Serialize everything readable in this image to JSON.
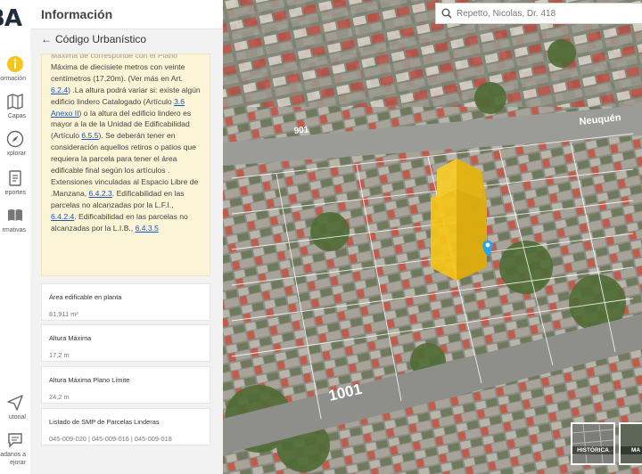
{
  "app": {
    "logo_text": "BA"
  },
  "rail": {
    "items": [
      {
        "label": "ormación",
        "icon": "info-icon"
      },
      {
        "label": "Capas",
        "icon": "map-layers-icon"
      },
      {
        "label": "xplorar",
        "icon": "compass-icon"
      },
      {
        "label": "eportes",
        "icon": "report-icon"
      },
      {
        "label": "rmativas",
        "icon": "book-icon"
      },
      {
        "label": "utorial",
        "icon": "paper-plane-icon"
      },
      {
        "label": "dadanos a\nejorar",
        "icon": "chat-icon"
      }
    ]
  },
  "panel": {
    "title": "Información",
    "back_label": "Código Urbanístico",
    "note": {
      "faded_line": "Máxima de corresponde con el Plano",
      "t1": "Máxima de diecisiete metros con veinte centímetros (17,20m). (Ver más en Art. ",
      "l1": "6.2.4",
      "t2": ") .La altura podrá variar si: existe algún edificio lindero Catalogado (Artículo ",
      "l2": "3.6 Anexo II",
      "t3": ") o la altura del edificio lindero es mayor a la de la Unidad de Edificabilidad (Artículo ",
      "l3": "6.5.5",
      "t4": "). Se deberán tener en consideración aquellos retiros o patios que requiera la parcela para tener el área edificable final según los artículos . Extensiones vinculadas al Espacio Libre de .Manzana, ",
      "l4": "6.4.2.3",
      "t5": ". Edificabilidad en las parcelas no alcanzadas por la L.F.I., ",
      "l5": "6.4.2.4",
      "t6": ". Edificabilidad en las parcelas no alcanzadas por la L.I.B., ",
      "l6": "6.4.3.5"
    },
    "cards": [
      {
        "label": "Área edificable en planta",
        "value": "81,911 m²"
      },
      {
        "label": "Altura Máxima",
        "value": "17,2 m"
      },
      {
        "label": "Altura Máxima Plano Límite",
        "value": "24,2 m"
      },
      {
        "label": "Listado de SMP de Parcelas Linderas",
        "value": "045-009-020 | 045-009-016 | 045-009-018"
      }
    ]
  },
  "map": {
    "search_value": "Repetto, Nicolas, Dr. 418",
    "street_labels": [
      "1001",
      "901",
      "Neuquén"
    ],
    "base_layers": [
      "HISTÓRICA",
      "MA"
    ],
    "colors": {
      "volume": "#f5c518",
      "pin": "#2aa6e8"
    }
  }
}
